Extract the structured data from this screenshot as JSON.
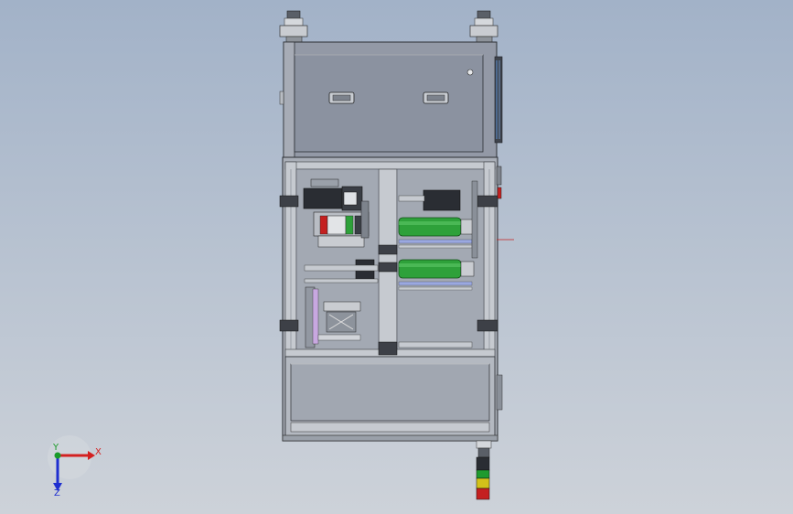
{
  "axis_triad": {
    "x_label": "X",
    "y_label": "Y",
    "z_label": "Z"
  },
  "colors": {
    "background_top": "#a2b2c8",
    "background_bottom": "#cdd2d9",
    "frame": "#aeb3bb",
    "panel": "#8d93a1",
    "roller": "#2ea13a",
    "motor": "#2a2d33",
    "triad_x": "#d32020",
    "triad_y": "#1a9a2a",
    "triad_z": "#1f2fd0",
    "light_red": "#c42020",
    "light_yellow": "#d3c21a",
    "light_green": "#1f9a2f"
  },
  "icons": [
    "axis-triad-icon",
    "signal-tower-light-icon"
  ]
}
